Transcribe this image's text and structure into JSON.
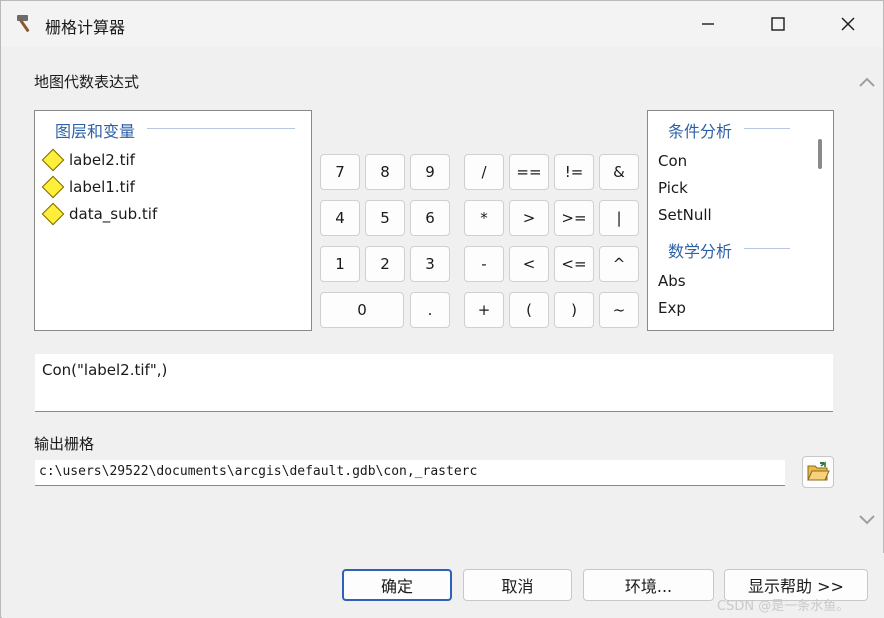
{
  "window": {
    "title": "栅格计算器",
    "icon": "hammer-icon",
    "minimize_icon": "minimize-icon",
    "maximize_icon": "maximize-icon",
    "close_icon": "close-icon"
  },
  "expression_section": {
    "label": "地图代数表达式"
  },
  "layers_panel": {
    "title": "图层和变量",
    "items": [
      {
        "label": "label2.tif",
        "icon": "raster-diamond-icon"
      },
      {
        "label": "label1.tif",
        "icon": "raster-diamond-icon"
      },
      {
        "label": "data_sub.tif",
        "icon": "raster-diamond-icon"
      }
    ]
  },
  "calculator": {
    "row1": [
      "7",
      "8",
      "9",
      "/",
      "==",
      "!=",
      "&"
    ],
    "row2": [
      "4",
      "5",
      "6",
      "*",
      ">",
      ">=",
      "|"
    ],
    "row3": [
      "1",
      "2",
      "3",
      "-",
      "<",
      "<=",
      "^"
    ],
    "row4": [
      "0",
      ".",
      "+",
      "(",
      ")",
      "~"
    ]
  },
  "functions_panel": {
    "group1_title": "条件分析",
    "group1_items": [
      "Con",
      "Pick",
      "SetNull"
    ],
    "group2_title": "数学分析",
    "group2_items": [
      "Abs",
      "Exp"
    ]
  },
  "expression": {
    "value": "Con(\"label2.tif\",)"
  },
  "output": {
    "label": "输出栅格",
    "value": "c:\\users\\29522\\documents\\arcgis\\default.gdb\\con,_rasterc",
    "browse_icon": "folder-open-icon"
  },
  "buttons": {
    "ok": "确定",
    "cancel": "取消",
    "environments": "环境...",
    "help": "显示帮助 >>"
  },
  "watermark": "CSDN @是一条水鱼。",
  "colors": {
    "group_title": "#2e62a8",
    "primary_border": "#2a63b8",
    "diamond_fill": "#ffef3a"
  }
}
